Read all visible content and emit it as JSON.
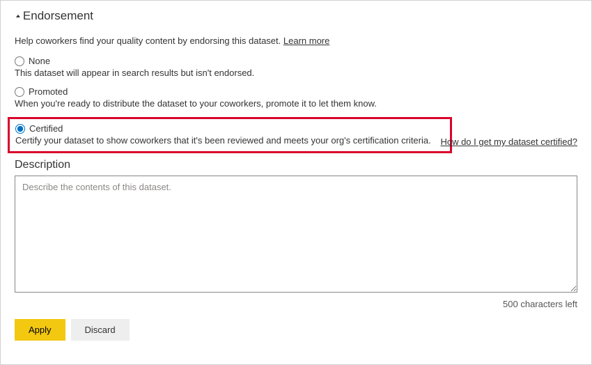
{
  "section": {
    "title": "Endorsement"
  },
  "help": {
    "text": "Help coworkers find your quality content by endorsing this dataset. ",
    "link": "Learn more"
  },
  "options": {
    "none": {
      "label": "None",
      "desc": "This dataset will appear in search results but isn't endorsed."
    },
    "promoted": {
      "label": "Promoted",
      "desc": "When you're ready to distribute the dataset to your coworkers, promote it to let them know."
    },
    "certified": {
      "label": "Certified",
      "desc": "Certify your dataset to show coworkers that it's been reviewed and meets your org's certification criteria. ",
      "link": "How do I get my dataset certified?"
    },
    "selected": "certified"
  },
  "description": {
    "label": "Description",
    "placeholder": "Describe the contents of this dataset.",
    "value": "",
    "counter": "500 characters left"
  },
  "buttons": {
    "apply": "Apply",
    "discard": "Discard"
  }
}
